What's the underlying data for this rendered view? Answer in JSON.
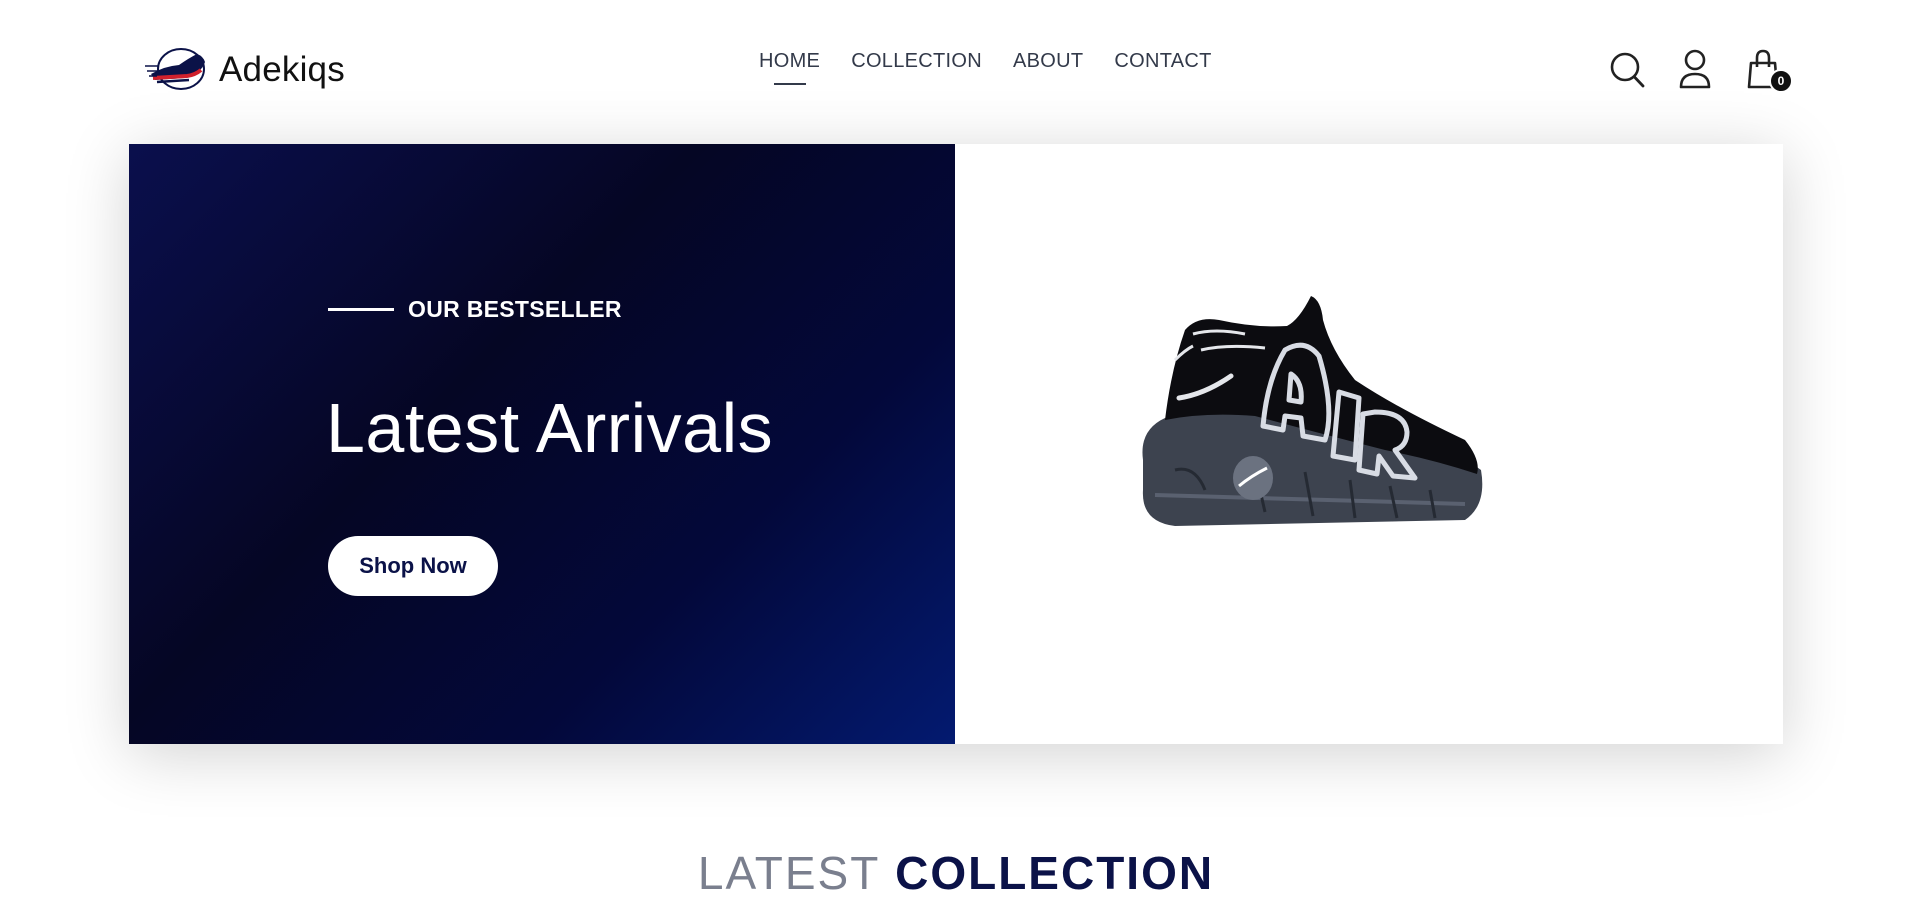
{
  "brand": {
    "name": "Adekiqs",
    "logo_icon": "sneaker-swoosh-logo",
    "colors": {
      "navy": "#0b1248",
      "red": "#d0202c",
      "black": "#111111"
    }
  },
  "nav": {
    "items": [
      {
        "label": "HOME",
        "active": true
      },
      {
        "label": "COLLECTION",
        "active": false
      },
      {
        "label": "ABOUT",
        "active": false
      },
      {
        "label": "CONTACT",
        "active": false
      }
    ]
  },
  "header_icons": {
    "search_icon": "search-icon",
    "profile_icon": "user-icon",
    "cart_icon": "shopping-bag-icon",
    "cart_count": "0"
  },
  "hero": {
    "eyebrow": "OUR BESTSELLER",
    "title": "Latest Arrivals",
    "cta_label": "Shop Now",
    "image_icon": "sneaker-image"
  },
  "latest_collection": {
    "light_word": "LATEST",
    "strong_word": "COLLECTION"
  }
}
